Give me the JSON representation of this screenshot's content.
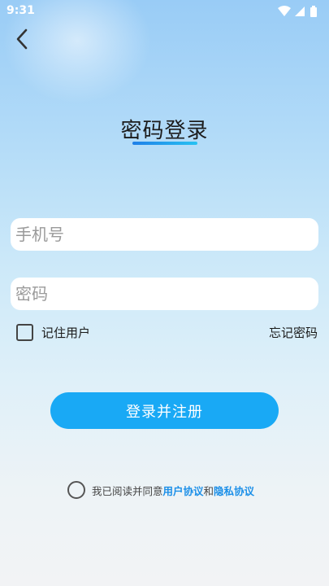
{
  "status_bar": {
    "time": "9:31",
    "icons": [
      "wifi-icon",
      "signal-icon",
      "battery-icon"
    ]
  },
  "header": {
    "back_icon": "chevron-left-icon"
  },
  "login": {
    "title": "密码登录",
    "phone_placeholder": "手机号",
    "password_placeholder": "密码",
    "remember_label": "记住用户",
    "forgot_label": "忘记密码",
    "submit_label": "登录并注册"
  },
  "agreement": {
    "prefix": "我已阅读并同意",
    "user_agreement": "用户协议",
    "conjunction": "和",
    "privacy_agreement": "隐私协议"
  },
  "colors": {
    "accent": "#19a9f5",
    "link": "#1b8fe8",
    "title_underline_start": "#1f7fe8",
    "title_underline_end": "#27c2f2"
  }
}
